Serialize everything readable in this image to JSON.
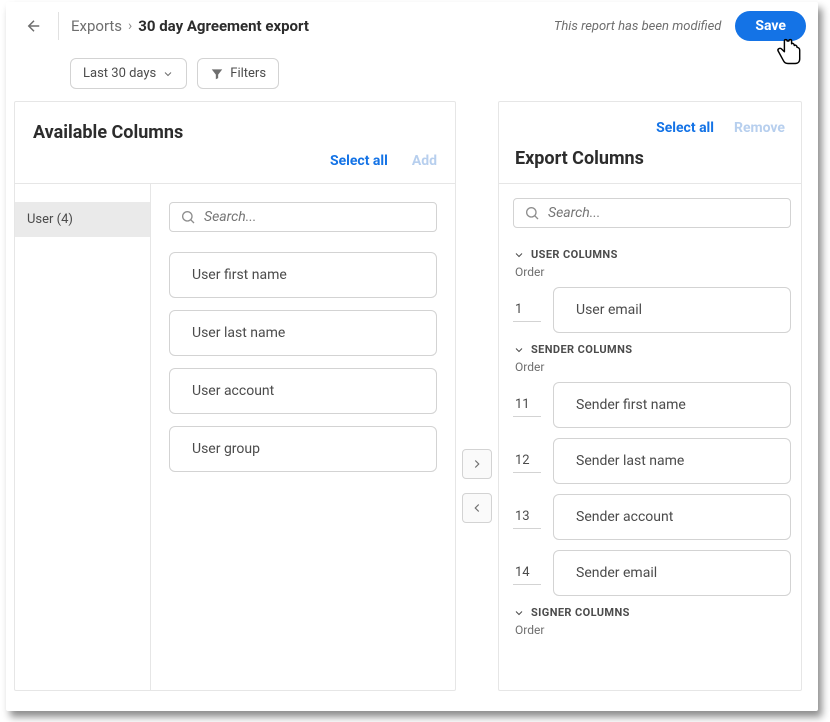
{
  "breadcrumb": {
    "root": "Exports",
    "title": "30 day Agreement export"
  },
  "header": {
    "modifiedNote": "This report has been modified",
    "saveLabel": "Save"
  },
  "toolbar": {
    "dateRange": "Last 30 days",
    "filtersLabel": "Filters"
  },
  "available": {
    "title": "Available Columns",
    "selectAll": "Select all",
    "add": "Add",
    "searchPlaceholder": "Search...",
    "category": {
      "label": "User (4)"
    },
    "columns": [
      {
        "label": "User first name"
      },
      {
        "label": "User last name"
      },
      {
        "label": "User account"
      },
      {
        "label": "User group"
      }
    ]
  },
  "export": {
    "title": "Export Columns",
    "selectAll": "Select all",
    "remove": "Remove",
    "searchPlaceholder": "Search...",
    "orderLabel": "Order",
    "groups": [
      {
        "name": "USER COLUMNS",
        "rows": [
          {
            "order": "1",
            "label": "User email"
          }
        ]
      },
      {
        "name": "SENDER COLUMNS",
        "rows": [
          {
            "order": "11",
            "label": "Sender first name"
          },
          {
            "order": "12",
            "label": "Sender last name"
          },
          {
            "order": "13",
            "label": "Sender account"
          },
          {
            "order": "14",
            "label": "Sender email"
          }
        ]
      },
      {
        "name": "SIGNER COLUMNS",
        "rows": []
      }
    ]
  }
}
